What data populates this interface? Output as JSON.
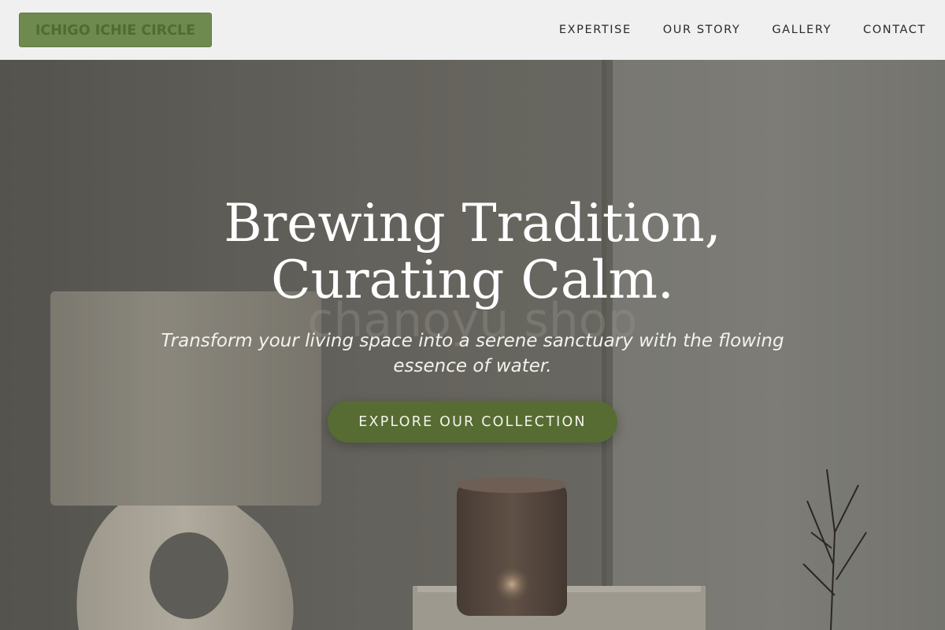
{
  "header": {
    "logo_text": "ICHIGO ICHIE CIRCLE",
    "nav": [
      {
        "label": "EXPERTISE"
      },
      {
        "label": "OUR STORY"
      },
      {
        "label": "GALLERY"
      },
      {
        "label": "CONTACT"
      }
    ]
  },
  "hero": {
    "title_line1": "Brewing Tradition,",
    "title_line2": "Curating Calm.",
    "watermark": "chanoyu shop",
    "subtitle": "Transform your living space into a serene sanctuary with the flowing essence of water.",
    "cta_label": "EXPLORE OUR COLLECTION"
  },
  "colors": {
    "header_bg": "#f0f0f0",
    "logo_bg": "#6f8a4e",
    "logo_text": "#506b33",
    "cta_bg": "#566c32",
    "hero_text": "#ffffff"
  }
}
